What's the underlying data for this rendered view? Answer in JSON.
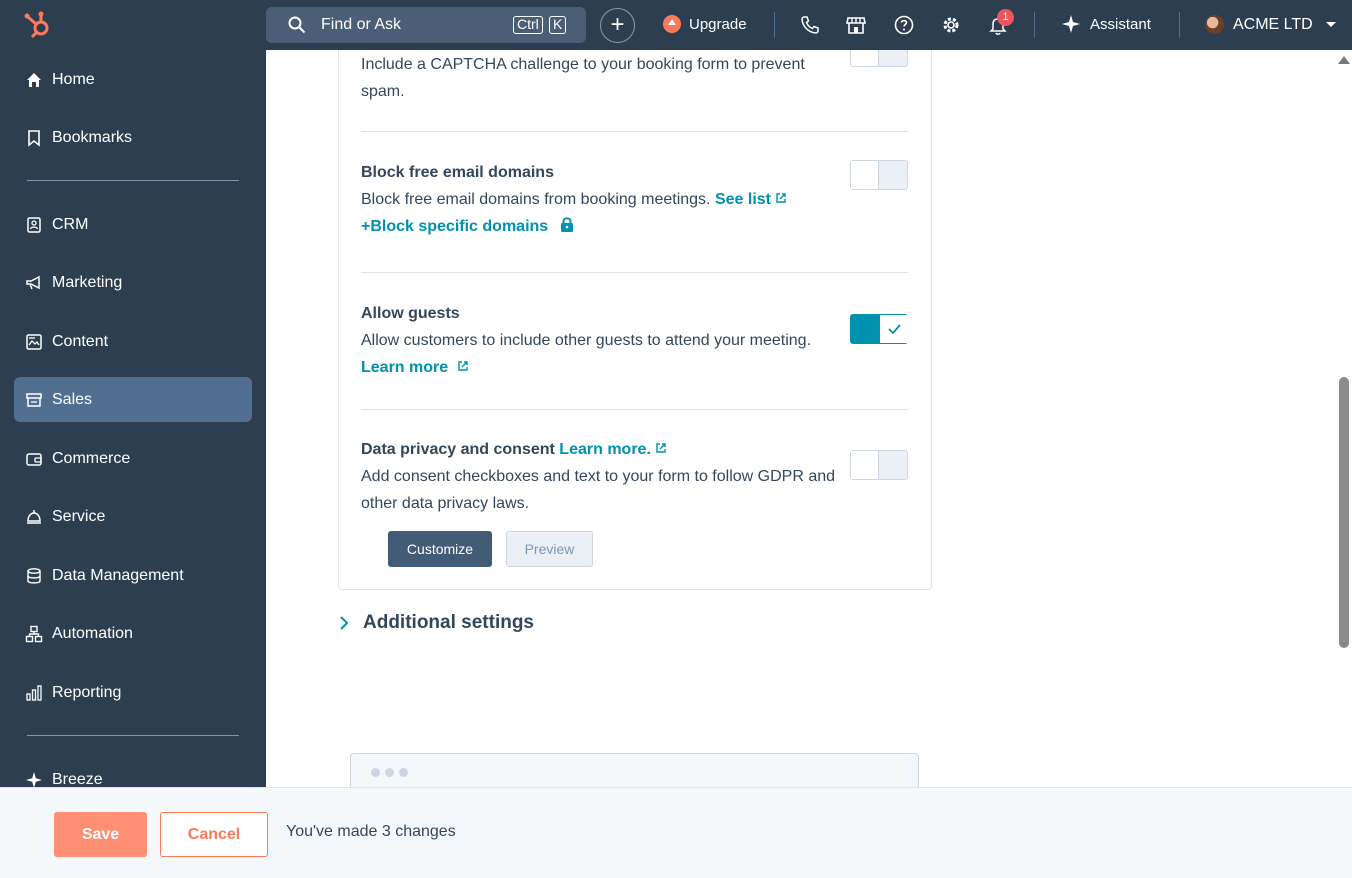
{
  "topbar": {
    "search_placeholder": "Find or Ask",
    "shortcut_ctrl": "Ctrl",
    "shortcut_k": "K",
    "upgrade_label": "Upgrade",
    "notification_count": "1",
    "assistant_label": "Assistant",
    "account_name": "ACME LTD"
  },
  "sidebar": {
    "items": [
      {
        "label": "Home",
        "icon": "home-icon"
      },
      {
        "label": "Bookmarks",
        "icon": "bookmark-icon"
      },
      {
        "label": "CRM",
        "icon": "contacts-icon"
      },
      {
        "label": "Marketing",
        "icon": "megaphone-icon"
      },
      {
        "label": "Content",
        "icon": "content-icon"
      },
      {
        "label": "Sales",
        "icon": "sales-icon",
        "active": true
      },
      {
        "label": "Commerce",
        "icon": "wallet-icon"
      },
      {
        "label": "Service",
        "icon": "bell-service-icon"
      },
      {
        "label": "Data Management",
        "icon": "database-icon"
      },
      {
        "label": "Automation",
        "icon": "automation-icon"
      },
      {
        "label": "Reporting",
        "icon": "chart-icon"
      },
      {
        "label": "Breeze",
        "icon": "sparkle-icon"
      }
    ]
  },
  "settings": {
    "captcha": {
      "description": "Include a CAPTCHA challenge to your booking form to prevent spam.",
      "enabled": false
    },
    "block_domains": {
      "title": "Block free email domains",
      "description": "Block free email domains from booking meetings.",
      "see_list": "See list",
      "block_specific": "Block specific domains",
      "enabled": false
    },
    "allow_guests": {
      "title": "Allow guests",
      "description": "Allow customers to include other guests to attend your meeting.",
      "learn_more": "Learn more",
      "enabled": true
    },
    "data_privacy": {
      "title": "Data privacy and consent",
      "learn_more": "Learn more.",
      "description": "Add consent checkboxes and text to your form to follow GDPR and other data privacy laws.",
      "customize_label": "Customize",
      "preview_label": "Preview",
      "enabled": false
    },
    "additional_settings": "Additional settings"
  },
  "footer": {
    "save_label": "Save",
    "cancel_label": "Cancel",
    "changes_text": "You've made 3 changes"
  },
  "colors": {
    "nav_bg": "#2d3e50",
    "accent_teal": "#0091ae",
    "save_orange": "#ff8f73"
  }
}
